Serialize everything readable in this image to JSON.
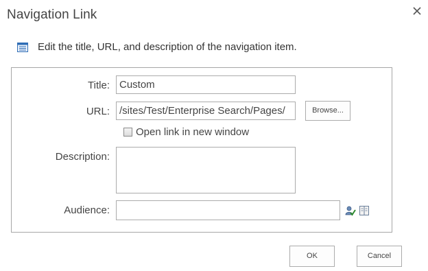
{
  "dialog": {
    "title": "Navigation Link",
    "close_icon": "close-icon"
  },
  "instruction": {
    "icon": "list-icon",
    "text": "Edit the title, URL, and description of the navigation item."
  },
  "form": {
    "title_label": "Title:",
    "title_value": "Custom",
    "url_label": "URL:",
    "url_value": "/sites/Test/Enterprise Search/Pages/",
    "browse_label": "Browse...",
    "open_new_window_label": "Open link in new window",
    "open_new_window_checked": false,
    "description_label": "Description:",
    "description_value": "",
    "audience_label": "Audience:",
    "audience_value": "",
    "check_names_icon": "check-names-icon",
    "browse_audience_icon": "address-book-icon"
  },
  "footer": {
    "ok_label": "OK",
    "cancel_label": "Cancel"
  }
}
